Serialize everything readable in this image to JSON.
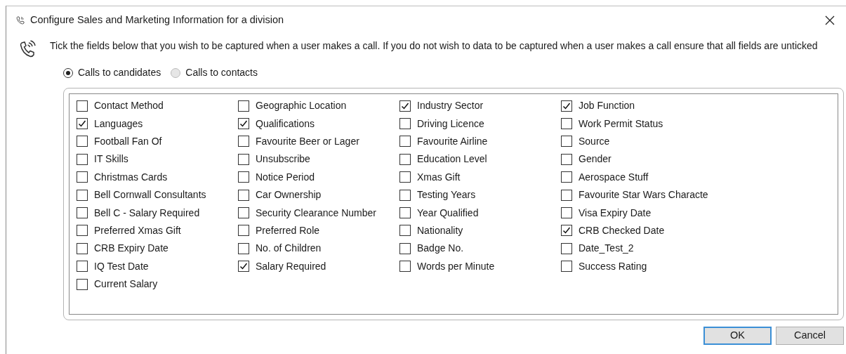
{
  "window": {
    "title": "Configure Sales and Marketing Information for a division"
  },
  "instructions": "Tick the fields below that you wish to be captured when a user makes a call. If you do not wish to data to be captured when a user makes a call ensure that all fields are unticked",
  "call_types": [
    {
      "label": "Calls to candidates",
      "selected": true
    },
    {
      "label": "Calls to contacts",
      "selected": false
    }
  ],
  "fields": [
    {
      "label": "Contact Method",
      "checked": false
    },
    {
      "label": "Geographic Location",
      "checked": false
    },
    {
      "label": "Industry Sector",
      "checked": true
    },
    {
      "label": "Job Function",
      "checked": true
    },
    {
      "label": "Languages",
      "checked": true
    },
    {
      "label": "Qualifications",
      "checked": true
    },
    {
      "label": "Driving Licence",
      "checked": false
    },
    {
      "label": "Work Permit Status",
      "checked": false
    },
    {
      "label": "Football Fan Of",
      "checked": false
    },
    {
      "label": "Favourite Beer or Lager",
      "checked": false
    },
    {
      "label": "Favourite Airline",
      "checked": false
    },
    {
      "label": "Source",
      "checked": false
    },
    {
      "label": "IT Skills",
      "checked": false
    },
    {
      "label": "Unsubscribe",
      "checked": false
    },
    {
      "label": "Education Level",
      "checked": false
    },
    {
      "label": "Gender",
      "checked": false
    },
    {
      "label": "Christmas Cards",
      "checked": false
    },
    {
      "label": "Notice Period",
      "checked": false
    },
    {
      "label": "Xmas Gift",
      "checked": false
    },
    {
      "label": "Aerospace Stuff",
      "checked": false
    },
    {
      "label": "Bell Cornwall Consultants",
      "checked": false
    },
    {
      "label": "Car Ownership",
      "checked": false
    },
    {
      "label": "Testing Years",
      "checked": false
    },
    {
      "label": "Favourite Star Wars Characte",
      "checked": false
    },
    {
      "label": "Bell C - Salary Required",
      "checked": false
    },
    {
      "label": "Security Clearance Number",
      "checked": false
    },
    {
      "label": "Year Qualified",
      "checked": false
    },
    {
      "label": "Visa Expiry Date",
      "checked": false
    },
    {
      "label": "Preferred Xmas Gift",
      "checked": false
    },
    {
      "label": "Preferred Role",
      "checked": false
    },
    {
      "label": "Nationality",
      "checked": false
    },
    {
      "label": "CRB Checked Date",
      "checked": true
    },
    {
      "label": "CRB Expiry Date",
      "checked": false
    },
    {
      "label": "No. of Children",
      "checked": false
    },
    {
      "label": "Badge No.",
      "checked": false
    },
    {
      "label": "Date_Test_2",
      "checked": false
    },
    {
      "label": "IQ Test Date",
      "checked": false
    },
    {
      "label": "Salary Required",
      "checked": true
    },
    {
      "label": "Words per Minute",
      "checked": false
    },
    {
      "label": "Success Rating",
      "checked": false
    },
    {
      "label": "Current Salary",
      "checked": false
    }
  ],
  "buttons": [
    {
      "label": "OK",
      "kind": "default"
    },
    {
      "label": "Cancel",
      "kind": "normal"
    }
  ]
}
